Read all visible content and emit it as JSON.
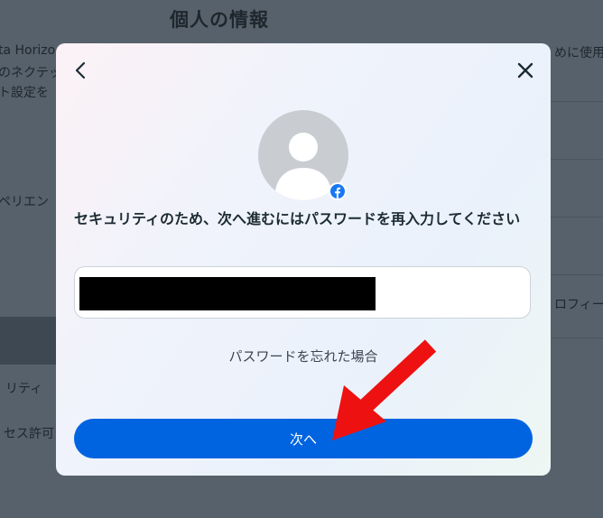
{
  "background": {
    "title": "個人の情報",
    "left_fragments": [
      "ta Horizo",
      "のネクテッ",
      "ト設定を",
      "ペリエン",
      "リティ",
      "セス許可"
    ],
    "right_fragments": [
      "めに使用",
      "ロフィー"
    ]
  },
  "modal": {
    "back_icon": "chevron-left-icon",
    "close_icon": "close-icon",
    "avatar_badge": "facebook-icon",
    "prompt": "セキュリティのため、次へ進むにはパスワードを再入力してください",
    "password_value": "",
    "forgot_link": "パスワードを忘れた場合",
    "next_button": "次へ"
  },
  "colors": {
    "primary": "#0064e0",
    "annotation_arrow": "#ee1111"
  }
}
